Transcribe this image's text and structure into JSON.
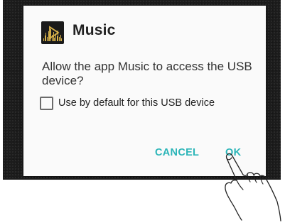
{
  "dialog": {
    "app_name": "Music",
    "app_icon": "music-app-icon",
    "message": "Allow the app Music to access the USB device?",
    "checkbox_label": "Use by default for this USB device",
    "checkbox_checked": false,
    "cancel_label": "CANCEL",
    "ok_label": "OK"
  },
  "colors": {
    "accent": "#2bb5b8",
    "dialog_bg": "#fafafa",
    "screen_bg": "#1c1c1c",
    "icon_bg": "#1a1a1a",
    "icon_accent": "#d8b24a"
  },
  "overlay": {
    "icon": "pointing-hand-icon"
  }
}
